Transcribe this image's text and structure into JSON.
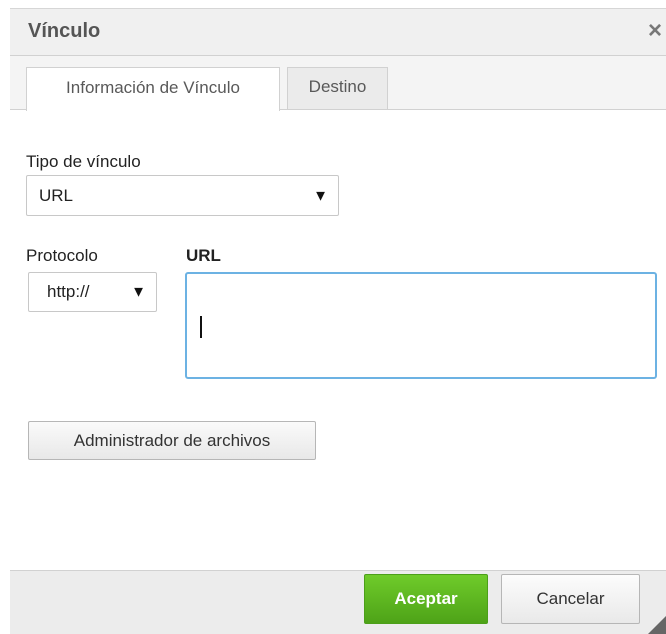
{
  "dialog": {
    "title": "Vínculo",
    "close_glyph": "×",
    "tabs": [
      {
        "label": "Información de Vínculo",
        "active": true
      },
      {
        "label": "Destino",
        "active": false
      }
    ],
    "link_type": {
      "label": "Tipo de vínculo",
      "value": "URL"
    },
    "protocol": {
      "label": "Protocolo",
      "value": "http://"
    },
    "url": {
      "label": "URL",
      "value": ""
    },
    "file_browser_label": "Administrador de archivos",
    "footer": {
      "ok_label": "Aceptar",
      "cancel_label": "Cancelar"
    }
  },
  "icons": {
    "close": "close-icon",
    "dropdown": "chevron-down-icon",
    "resize": "resize-grip-icon"
  },
  "colors": {
    "ok_button": "#5cb820",
    "input_focus": "#6cb2e3"
  }
}
